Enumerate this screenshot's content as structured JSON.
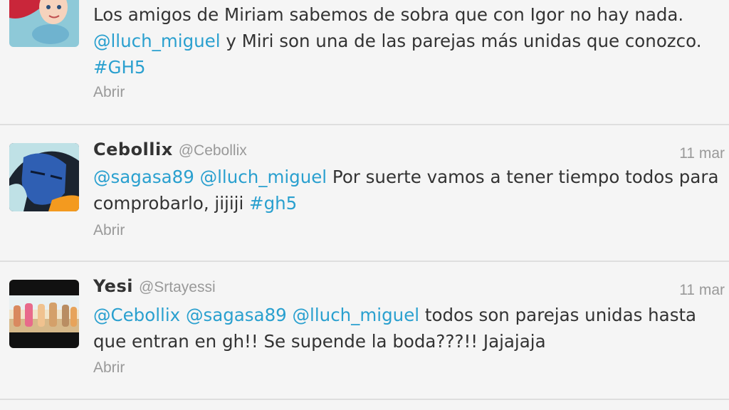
{
  "colors": {
    "background": "#f5f5f5",
    "link": "#2aa0cf",
    "text": "#333333",
    "muted": "#999999",
    "divider": "#dedede"
  },
  "tweets": [
    {
      "avatar_icon": "mermaid-avatar-icon",
      "text": {
        "p1": "Los amigos de Miriam sabemos de sobra que con Igor no hay nada. ",
        "m1": "@lluch_miguel",
        "p2": "  y Miri son una de las parejas más unidas que conozco. ",
        "h1": "#GH5"
      },
      "action": "Abrir"
    },
    {
      "name": "Cebollix",
      "handle": "@Cebollix",
      "time": "11 mar",
      "avatar_icon": "cartoon-blue-face-avatar-icon",
      "text": {
        "m1": "@sagasa89",
        "s1": " ",
        "m2": "@lluch_miguel",
        "p1": " Por suerte vamos a tener tiempo todos para comprobarlo, jijiji ",
        "h1": "#gh5"
      },
      "action": "Abrir"
    },
    {
      "name": "Yesi",
      "handle": "@Srtayessi",
      "time": "11 mar",
      "avatar_icon": "group-photo-avatar-icon",
      "text": {
        "m1": "@Cebollix",
        "s1": " ",
        "m2": "@sagasa89",
        "s2": " ",
        "m3": "@lluch_miguel",
        "p1": " todos son parejas unidas hasta que entran en gh!! Se supende la boda???!! Jajajaja"
      },
      "action": "Abrir"
    }
  ]
}
